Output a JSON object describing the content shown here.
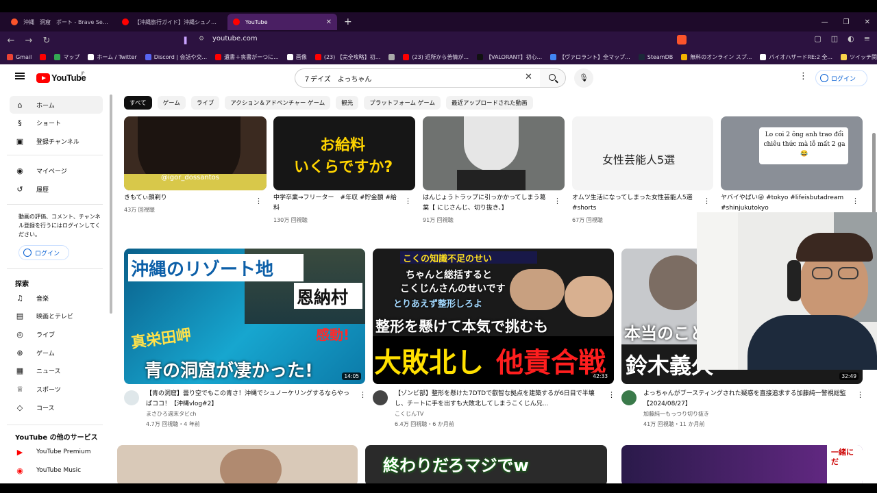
{
  "browser": {
    "tabs": [
      {
        "label": "沖縄　洞窟　ボート - Brave Search",
        "color": "#fb542b"
      },
      {
        "label": "【沖縄旅行ガイド】沖縄シュノーケリングス",
        "color": "#ff0000"
      },
      {
        "label": "YouTube",
        "color": "#ff0000",
        "active": true
      }
    ],
    "url": "youtube.com",
    "bookmarks": [
      {
        "label": "Gmail",
        "color": "#ea4335"
      },
      {
        "label": "",
        "color": "#ff0000"
      },
      {
        "label": "マップ",
        "color": "#34a853"
      },
      {
        "label": "ホーム / Twitter",
        "color": "#ffffff"
      },
      {
        "label": "Discord | 会話や交...",
        "color": "#5865f2"
      },
      {
        "label": "遺書＋喪書がーつに...",
        "color": "#ff0000"
      },
      {
        "label": "画像",
        "color": "#ffffff"
      },
      {
        "label": "(23) 【完全攻略】初...",
        "color": "#ff0000"
      },
      {
        "label": "",
        "color": "#aaaaaa"
      },
      {
        "label": "(23) 近所から苦情が...",
        "color": "#ff0000"
      },
      {
        "label": "【VALORANT】初心...",
        "color": "#111111"
      },
      {
        "label": "【ヴァロラント】全マップ...",
        "color": "#4285f4"
      },
      {
        "label": "SteamDB",
        "color": "#1b2838"
      },
      {
        "label": "無料のオンライン スプ...",
        "color": "#f4b400"
      },
      {
        "label": "バイオハザードRE:2 全...",
        "color": "#ffffff"
      },
      {
        "label": "ツイッチ関連",
        "color": "#f9d34a"
      }
    ]
  },
  "masthead": {
    "logo": "YouTube",
    "logo_region": "JP",
    "search_value": "７デイズ　よっちゃん",
    "login": "ログイン"
  },
  "sidebar": {
    "main": [
      {
        "label": "ホーム",
        "icon": "home-icon",
        "glyph": "⌂",
        "active": true
      },
      {
        "label": "ショート",
        "icon": "shorts-icon",
        "glyph": "§"
      },
      {
        "label": "登録チャンネル",
        "icon": "subscriptions-icon",
        "glyph": "▣"
      }
    ],
    "you": [
      {
        "label": "マイページ",
        "icon": "account-icon",
        "glyph": "◉"
      },
      {
        "label": "履歴",
        "icon": "history-icon",
        "glyph": "↺"
      }
    ],
    "note": "動画の評価、コメント、チャンネル登録を行うにはログインしてください。",
    "login": "ログイン",
    "explore_heading": "探索",
    "explore": [
      {
        "label": "音楽",
        "icon": "music-icon",
        "glyph": "♫"
      },
      {
        "label": "映画とテレビ",
        "icon": "movies-icon",
        "glyph": "▤"
      },
      {
        "label": "ライブ",
        "icon": "live-icon",
        "glyph": "◎"
      },
      {
        "label": "ゲーム",
        "icon": "gaming-icon",
        "glyph": "⊕"
      },
      {
        "label": "ニュース",
        "icon": "news-icon",
        "glyph": "▦"
      },
      {
        "label": "スポーツ",
        "icon": "sports-icon",
        "glyph": "♕"
      },
      {
        "label": "コース",
        "icon": "courses-icon",
        "glyph": "◇"
      }
    ],
    "more_heading": "YouTube の他のサービス",
    "more": [
      {
        "label": "YouTube Premium",
        "icon": "youtube-premium-icon",
        "color": "#ff0000"
      },
      {
        "label": "YouTube Music",
        "icon": "youtube-music-icon",
        "color": "#ff0000"
      }
    ]
  },
  "chips": [
    "すべて",
    "ゲーム",
    "ライブ",
    "アクション＆アドベンチャー ゲーム",
    "観光",
    "プラットフォーム ゲーム",
    "最近アップロードされた動画"
  ],
  "shorts": [
    {
      "title": "きもてぃ顔剃り",
      "views": "43万 回視聴",
      "thumb_text": "@igor_dossantos"
    },
    {
      "title": "中学卒業→フリーター　#年収 #貯金額 #給料",
      "views": "130万 回視聴",
      "thumb_text": "お給料\nいくらですか?"
    },
    {
      "title": "はんじょうトラップに引っかかってしまう葛葉【 にじさんじ、切り抜き、】",
      "views": "91万 回視聴",
      "thumb_text": ""
    },
    {
      "title": "オムツ生活になってしまった女性芸能人5選#shorts",
      "views": "67万 回視聴",
      "thumb_text": "女性芸能人5選"
    },
    {
      "title": "ヤバイやばい😜 #tokyo #lifeisbutadream #shinjukutokyo",
      "views": "",
      "thumb_text": "Lo coi 2 ông anh trao đổi chiêu thức mà lỗ mất 2 ga😂"
    }
  ],
  "videos": [
    {
      "title": "【青の洞窟】曇り空でもこの青さ！沖縄でシュノーケリングするならやっぱココ！【沖縄vlog#2】",
      "channel": "まさひろ週末タビch",
      "meta": "4.7万 回視聴・4 年前",
      "duration": "14:05",
      "thumb_lines": [
        "沖縄のリゾート地",
        "恩納村",
        "真栄田岬",
        "感動!",
        "青の洞窟が凄かった!"
      ]
    },
    {
      "title": "【ゾンビ部】整形を懸けた7DTDで叡智な拠点を建築するが6日目で半壊し、チートに手を出すも大敗北してしまうこくじん兄...",
      "channel": "こくじんTV",
      "meta": "6.4万 回視聴・6 か月前",
      "duration": "42:33",
      "thumb_lines": [
        "こくの知識不足のせい",
        "ちゃんと総括すると",
        "こくじんさんのせいです",
        "とりあえず整形しろよ",
        "整形を懸けて本気で挑むも",
        "大敗北し",
        "他責合戦"
      ]
    },
    {
      "title": "よっちゃんがブースティングされた疑惑を直接追求する加藤純一警視総監【2024/08/27】",
      "channel": "加藤純一もっつり切り抜き",
      "meta": "41万 回視聴・11 か月前",
      "duration": "32:49",
      "thumb_lines": [
        "本当のこと",
        "鈴木義久"
      ]
    }
  ],
  "bottom_row": [
    {
      "thumb_text": ""
    },
    {
      "thumb_text": "終わりだろマジでw"
    },
    {
      "thumb_text": "一緒にだ"
    }
  ]
}
